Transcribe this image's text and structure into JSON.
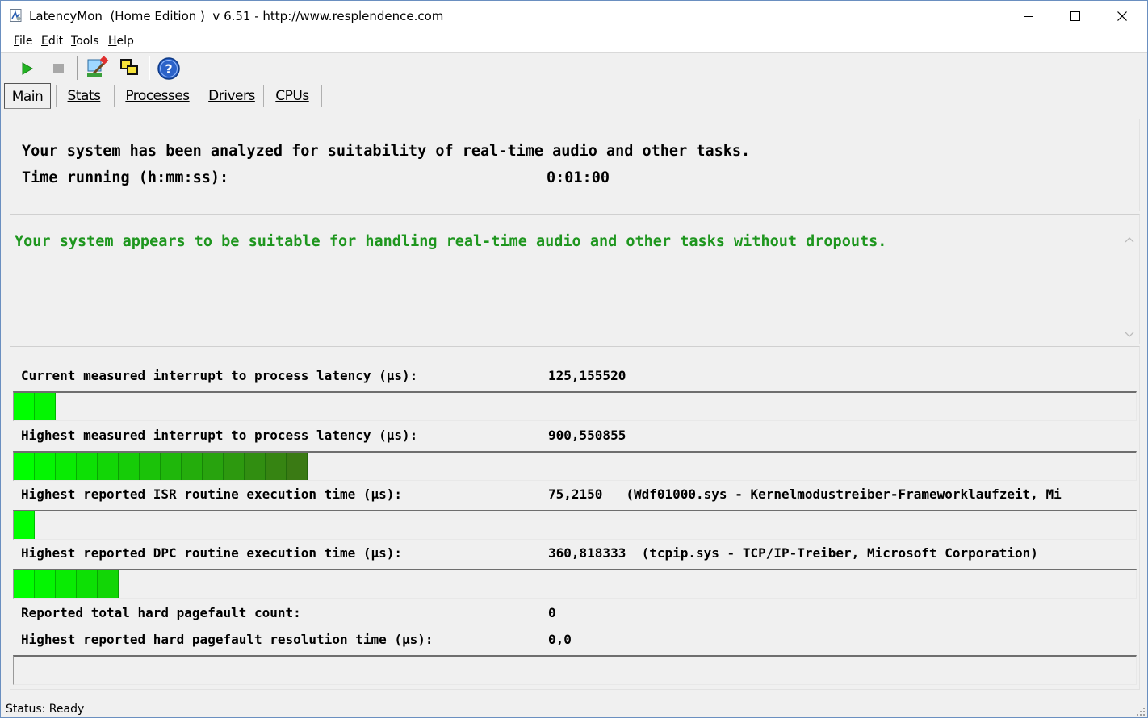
{
  "window": {
    "title": "LatencyMon  (Home Edition )  v 6.51 - http://www.resplendence.com"
  },
  "menu": [
    {
      "label": "File",
      "accel": "F",
      "rest": "ile"
    },
    {
      "label": "Edit",
      "accel": "E",
      "rest": "dit"
    },
    {
      "label": "Tools",
      "accel": "T",
      "rest": "ools"
    },
    {
      "label": "Help",
      "accel": "H",
      "rest": "elp"
    }
  ],
  "toolbar": {
    "icons": [
      "play-icon",
      "stop-icon",
      "settings-icon",
      "windows-icon",
      "help-icon"
    ]
  },
  "tabs": [
    {
      "label": "Main",
      "active": true
    },
    {
      "label": "Stats",
      "active": false
    },
    {
      "label": "Processes",
      "active": false
    },
    {
      "label": "Drivers",
      "active": false
    },
    {
      "label": "CPUs",
      "active": false
    }
  ],
  "analysis": {
    "line1": "Your system has been analyzed for suitability of real-time audio and other tasks.",
    "time_label": "Time running (h:mm:ss):",
    "time_value": "0:01:00"
  },
  "verdict": {
    "text": "Your system appears to be suitable for handling real-time audio and other tasks without dropouts.",
    "color": "#1e961e"
  },
  "metrics": [
    {
      "label": "Current measured interrupt to process latency (µs):",
      "value": "125,155520",
      "bar_segments": 2
    },
    {
      "label": "Highest measured interrupt to process latency (µs):",
      "value": "900,550855",
      "bar_segments": 14
    },
    {
      "label": "Highest reported ISR routine execution time (µs):",
      "value": "75,2150   (Wdf01000.sys - Kernelmodustreiber-Frameworklaufzeit, Mi",
      "bar_segments": 1
    },
    {
      "label": "Highest reported DPC routine execution time (µs):",
      "value": "360,818333  (tcpip.sys - TCP/IP-Treiber, Microsoft Corporation)",
      "bar_segments": 5
    },
    {
      "label": "Reported total hard pagefault count:",
      "value": "0"
    },
    {
      "label": "Highest reported hard pagefault resolution time (µs):",
      "value": "0,0",
      "bar_segments": 0
    }
  ],
  "status": {
    "text": "Status: Ready"
  },
  "colors": {
    "bar_light": "#00ff00",
    "bar_dark": "#3a7a14",
    "accent": "#1e961e"
  }
}
